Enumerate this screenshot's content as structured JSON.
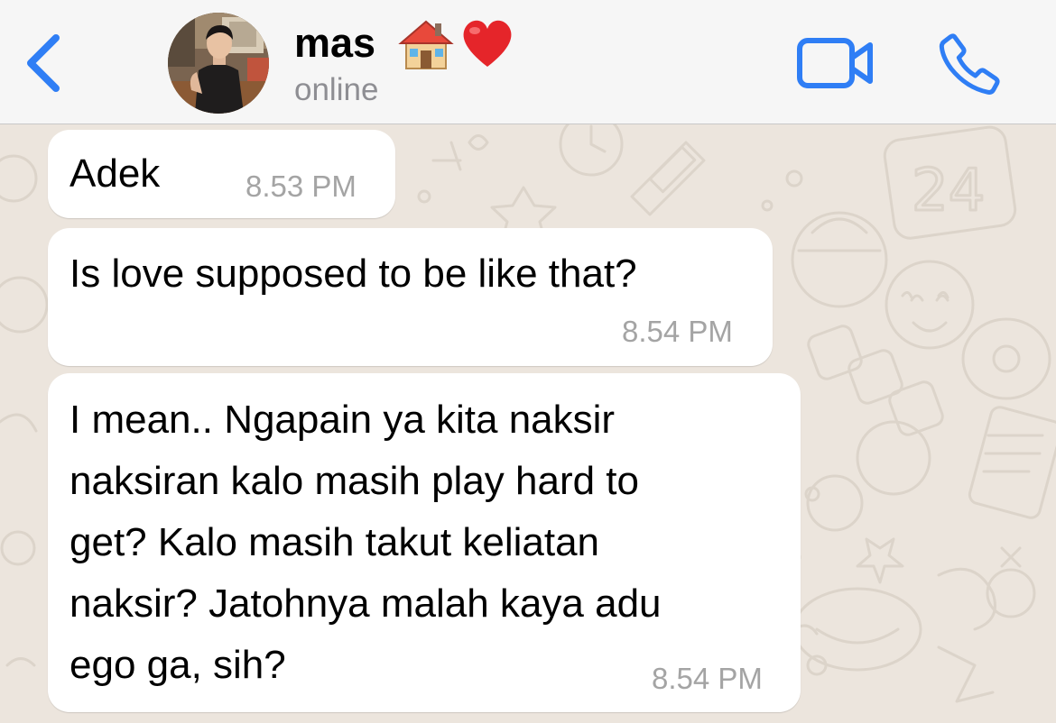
{
  "header": {
    "back_icon": "chevron-left-icon",
    "contact_name": "mas",
    "name_emojis": [
      "house-emoji",
      "red-heart-emoji"
    ],
    "status": "online",
    "actions": [
      "video-camera-icon",
      "phone-icon"
    ],
    "accent_color": "#2f7ef5"
  },
  "chat": {
    "wallpaper_color": "#ece5dd",
    "bubble_color": "#ffffff",
    "messages": [
      {
        "text": "Adek",
        "time": "8.53 PM"
      },
      {
        "text": "Is love supposed to be like that?",
        "time": "8.54 PM"
      },
      {
        "text": "I mean.. Ngapain ya kita naksir\nnaksiran kalo masih play hard to\nget? Kalo masih takut keliatan\nnaksir? Jatohnya malah kaya adu\nego ga, sih?",
        "time": "8.54 PM"
      }
    ]
  }
}
